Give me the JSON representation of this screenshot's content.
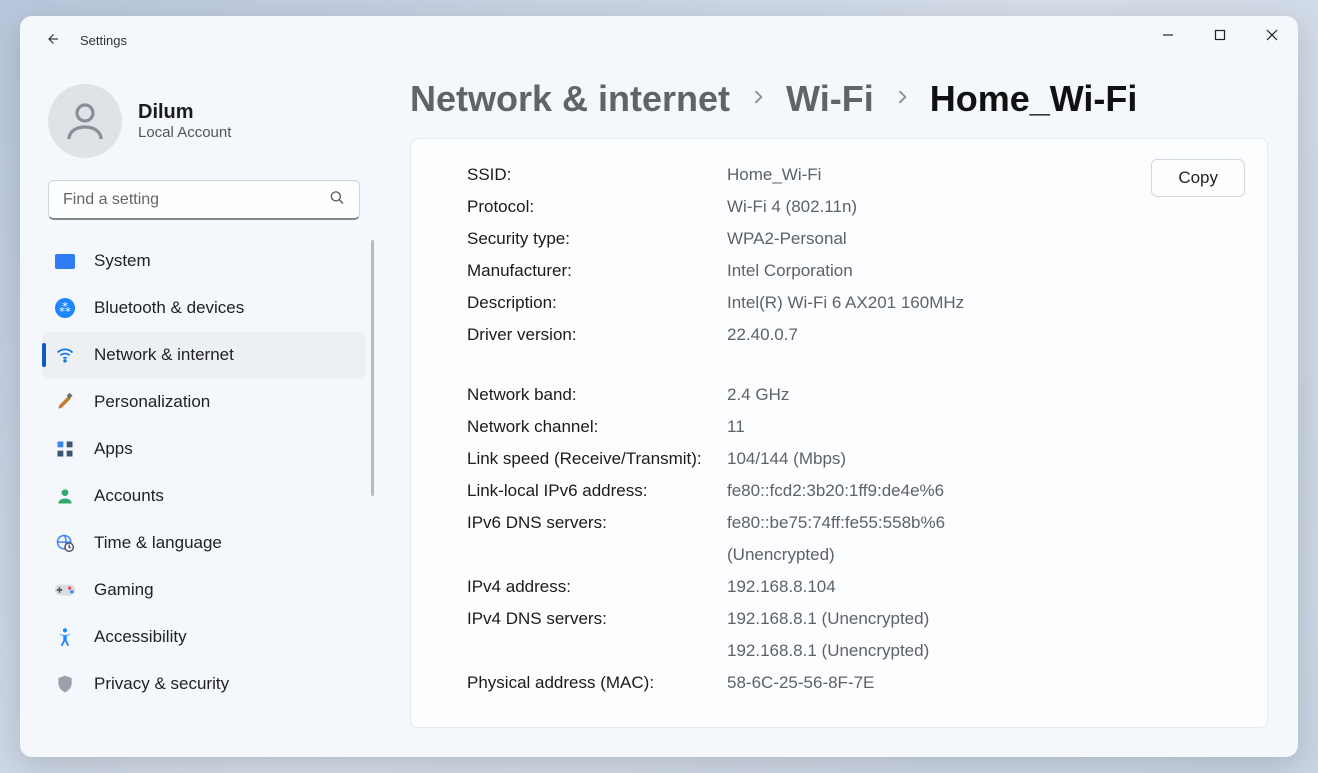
{
  "titlebar": {
    "title": "Settings"
  },
  "profile": {
    "name": "Dilum",
    "type": "Local Account"
  },
  "search": {
    "placeholder": "Find a setting"
  },
  "sidebar": {
    "items": [
      {
        "id": "system",
        "label": "System"
      },
      {
        "id": "bluetooth",
        "label": "Bluetooth & devices"
      },
      {
        "id": "network",
        "label": "Network & internet",
        "selected": true
      },
      {
        "id": "personalization",
        "label": "Personalization"
      },
      {
        "id": "apps",
        "label": "Apps"
      },
      {
        "id": "accounts",
        "label": "Accounts"
      },
      {
        "id": "time",
        "label": "Time & language"
      },
      {
        "id": "gaming",
        "label": "Gaming"
      },
      {
        "id": "accessibility",
        "label": "Accessibility"
      },
      {
        "id": "privacy",
        "label": "Privacy & security"
      }
    ]
  },
  "breadcrumb": {
    "0": "Network & internet",
    "1": "Wi-Fi",
    "2": "Home_Wi-Fi"
  },
  "copy_label": "Copy",
  "details": {
    "ssid": {
      "label": "SSID:",
      "value": "Home_Wi-Fi"
    },
    "protocol": {
      "label": "Protocol:",
      "value": "Wi-Fi 4 (802.11n)"
    },
    "security": {
      "label": "Security type:",
      "value": "WPA2-Personal"
    },
    "manufacturer": {
      "label": "Manufacturer:",
      "value": "Intel Corporation"
    },
    "description": {
      "label": "Description:",
      "value": "Intel(R) Wi-Fi 6 AX201 160MHz"
    },
    "driver": {
      "label": "Driver version:",
      "value": "22.40.0.7"
    },
    "band": {
      "label": "Network band:",
      "value": "2.4 GHz"
    },
    "channel": {
      "label": "Network channel:",
      "value": "11"
    },
    "linkspeed": {
      "label": "Link speed (Receive/Transmit):",
      "value": "104/144 (Mbps)"
    },
    "linklocal6": {
      "label": "Link-local IPv6 address:",
      "value": "fe80::fcd2:3b20:1ff9:de4e%6"
    },
    "dns6": {
      "label": "IPv6 DNS servers:",
      "value": "fe80::be75:74ff:fe55:558b%6\n(Unencrypted)"
    },
    "ipv4": {
      "label": "IPv4 address:",
      "value": "192.168.8.104"
    },
    "dns4": {
      "label": "IPv4 DNS servers:",
      "value": "192.168.8.1 (Unencrypted)\n192.168.8.1 (Unencrypted)"
    },
    "mac": {
      "label": "Physical address (MAC):",
      "value": "58-6C-25-56-8F-7E"
    }
  }
}
